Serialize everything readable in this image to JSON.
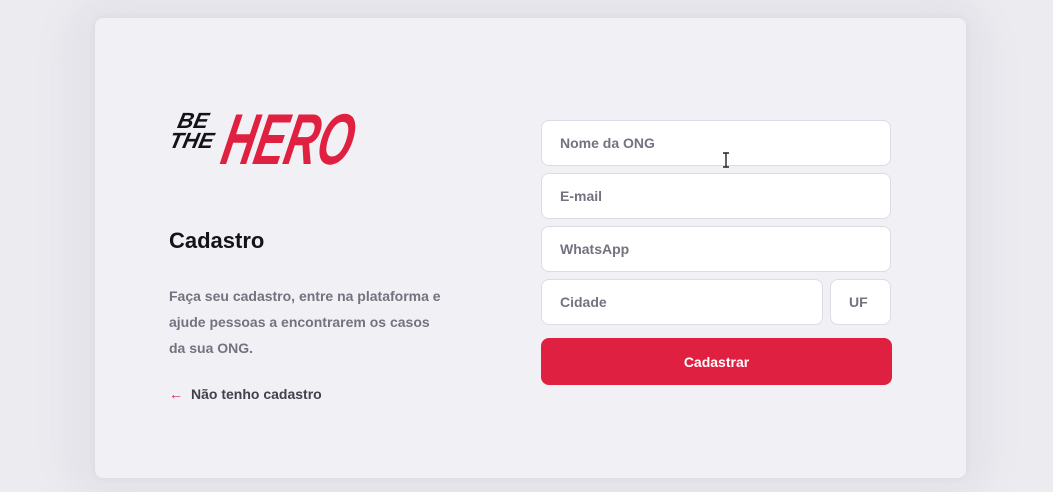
{
  "logo": {
    "line_small_1": "BE",
    "line_small_2": "THE",
    "line_big": "HERO"
  },
  "page": {
    "title": "Cadastro",
    "description": "Faça seu cadastro, entre na plataforma e ajude pessoas a encontrarem os casos da sua ONG.",
    "back_link": "Não tenho cadastro"
  },
  "form": {
    "name_placeholder": "Nome da ONG",
    "email_placeholder": "E-mail",
    "whatsapp_placeholder": "WhatsApp",
    "city_placeholder": "Cidade",
    "uf_placeholder": "UF",
    "submit_label": "Cadastrar"
  },
  "colors": {
    "brand": "#e02041",
    "background": "#f0f0f5",
    "text_dark": "#13131a",
    "text_muted": "#737380"
  },
  "icons": {
    "back": "arrow-left-icon",
    "cursor": "text-cursor-icon"
  }
}
